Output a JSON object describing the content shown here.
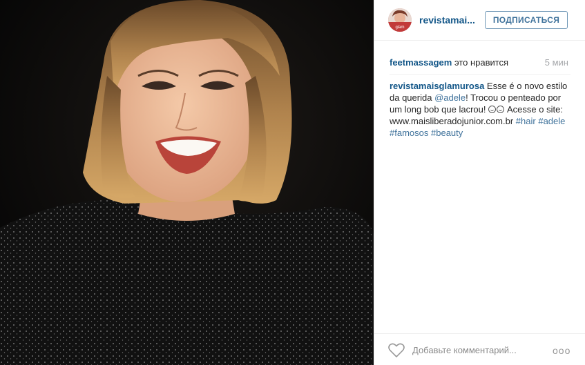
{
  "post": {
    "photo_alt": "Photo",
    "author": {
      "username": "revistamai...",
      "follow_label": "ПОДПИСАТЬСЯ"
    },
    "likes": {
      "liker": "feetmassagem",
      "text": " это нравится",
      "time": "5 мин"
    },
    "caption": {
      "author": "revistamaisglamurosa",
      "part1": " Esse é o novo estilo da querida ",
      "mention": "@adele",
      "part2": "! Trocou o penteado por um long bob que lacrou! ",
      "part3": " Acesse o site: www.maisliberadojunior.com.br ",
      "tags": [
        "#hair",
        "#adele",
        "#famosos",
        "#beauty"
      ]
    },
    "comment": {
      "placeholder": "Добавьте комментарий...",
      "more_label": "ooo"
    }
  },
  "colors": {
    "link": "#125688",
    "hashtag": "#3f729b",
    "follow_border": "#6f97b6",
    "text": "#262626",
    "muted": "#a5a7aa"
  }
}
